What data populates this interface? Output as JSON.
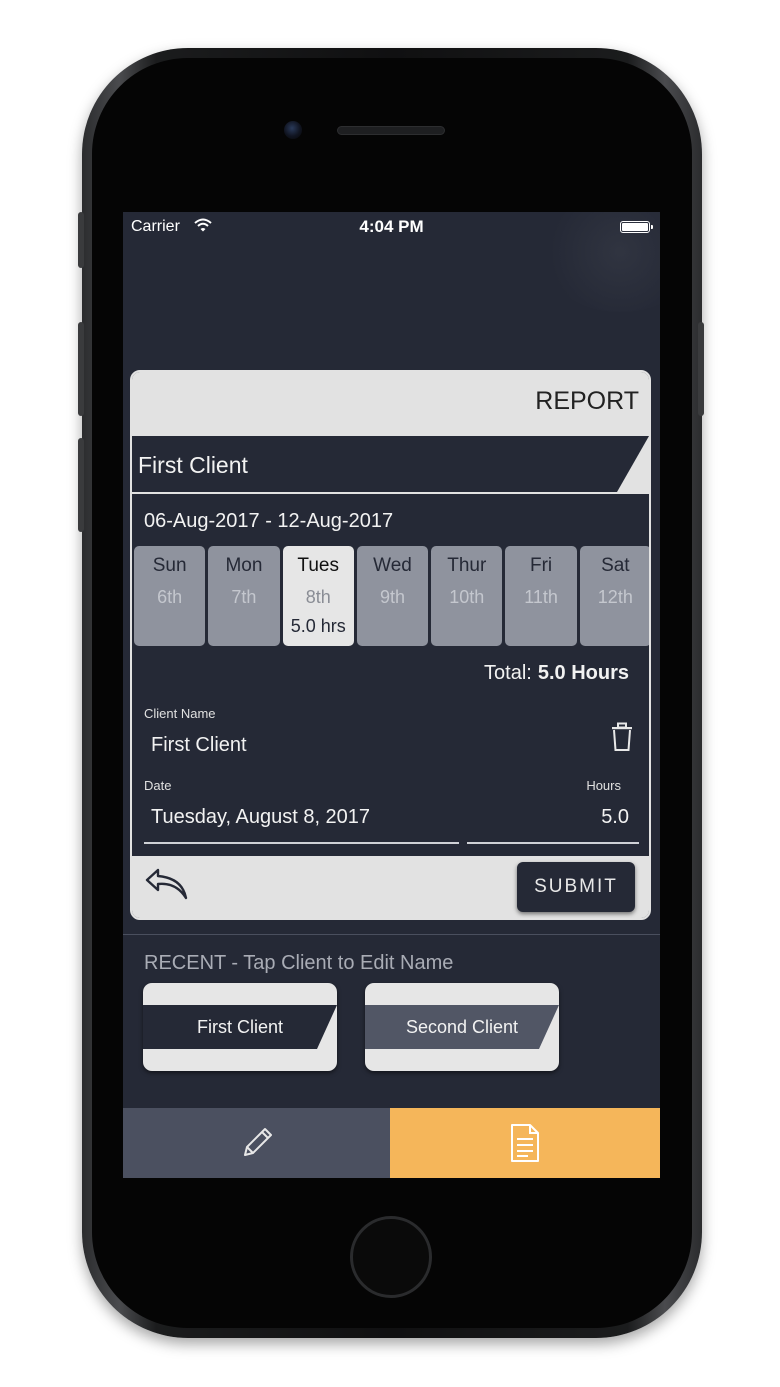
{
  "status_bar": {
    "carrier": "Carrier",
    "time": "4:04 PM"
  },
  "report": {
    "title": "REPORT",
    "client_banner": "First Client",
    "date_range": "06-Aug-2017 - 12-Aug-2017",
    "days": [
      {
        "name": "Sun",
        "date": "6th",
        "hours": ""
      },
      {
        "name": "Mon",
        "date": "7th",
        "hours": ""
      },
      {
        "name": "Tues",
        "date": "8th",
        "hours": "5.0 hrs"
      },
      {
        "name": "Wed",
        "date": "9th",
        "hours": ""
      },
      {
        "name": "Thur",
        "date": "10th",
        "hours": ""
      },
      {
        "name": "Fri",
        "date": "11th",
        "hours": ""
      },
      {
        "name": "Sat",
        "date": "12th",
        "hours": ""
      }
    ],
    "selected_day": "Tues",
    "total_label": "Total:",
    "total_value": "5.0 Hours",
    "client_name_label": "Client Name",
    "client_name_value": "First Client",
    "date_label": "Date",
    "date_value": "Tuesday, August 8, 2017",
    "hours_label": "Hours",
    "hours_value": "5.0",
    "submit_label": "SUBMIT"
  },
  "recent": {
    "title": "RECENT - Tap Client to Edit Name",
    "clients": [
      "First Client",
      "Second Client"
    ]
  },
  "tabs": [
    {
      "icon": "pencil-icon",
      "active": false
    },
    {
      "icon": "document-icon",
      "active": true
    }
  ],
  "colors": {
    "background": "#252936",
    "card_light": "#e2e2e2",
    "day_inactive": "#8f939e",
    "active_tab": "#f5b65a",
    "inactive_tab": "#4b5060"
  }
}
